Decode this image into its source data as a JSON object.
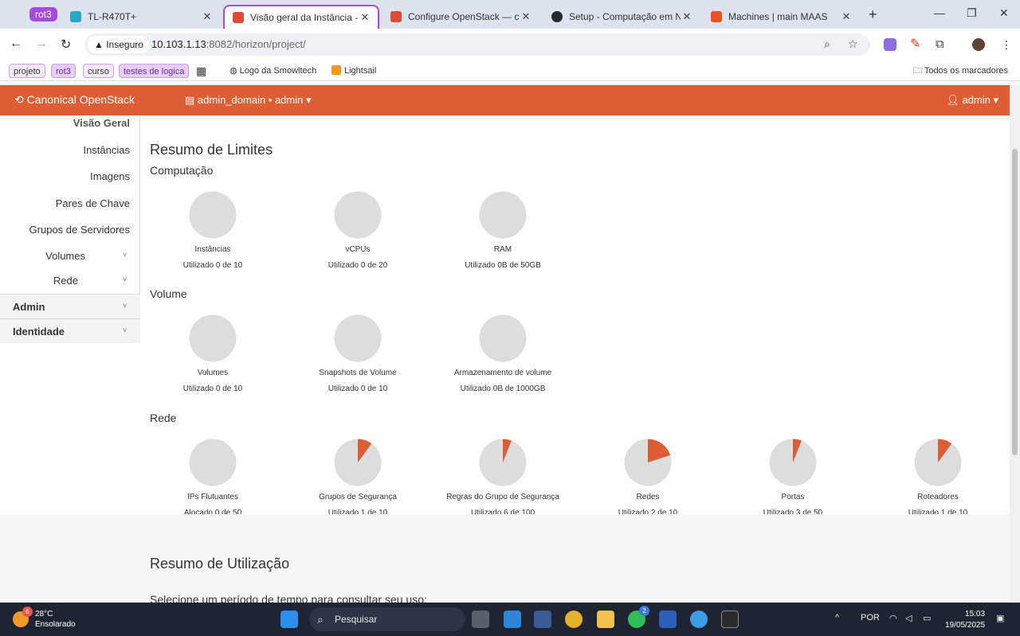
{
  "browser": {
    "tab_group": "rot3",
    "tabs": [
      {
        "title": "TL-R470T+",
        "icon": "tp-link-icon",
        "color": "#2aa6c9"
      },
      {
        "title": "Visão geral da Instância - Op",
        "icon": "openstack-icon",
        "color": "#dd4b39",
        "active": true
      },
      {
        "title": "Configure OpenStack — charm",
        "icon": "openstack-icon",
        "color": "#dd4b39"
      },
      {
        "title": "Setup - Computação em Nuvem",
        "icon": "github-icon",
        "color": "#24292e"
      },
      {
        "title": "Machines | main MAAS",
        "icon": "maas-icon",
        "color": "#e95420"
      }
    ],
    "security_label": "Inseguro",
    "url_host": "10.103.1.13",
    "url_rest": ":8082/horizon/project/",
    "bookmarks": [
      "projeto",
      "rot3",
      "curso",
      "testes de logica",
      "Logo da Smowltech",
      "Lightsail"
    ],
    "all_bookmarks": "Todos os marcadores"
  },
  "header": {
    "brand": "Canonical OpenStack",
    "project_selector": "admin_domain • admin",
    "user": "admin"
  },
  "sidebar": {
    "current": "Visão Geral",
    "items": [
      "Instâncias",
      "Imagens",
      "Pares de Chave",
      "Grupos de Servidores",
      "Volumes",
      "Rede"
    ],
    "sections": [
      "Admin",
      "Identidade"
    ]
  },
  "main": {
    "title": "Resumo de Limites",
    "groups": [
      {
        "title": "Computação",
        "charts": [
          {
            "label": "Instâncias",
            "usage": "Utilizado 0 de 10",
            "fraction": 0
          },
          {
            "label": "vCPUs",
            "usage": "Utilizado 0 de 20",
            "fraction": 0
          },
          {
            "label": "RAM",
            "usage": "Utilizado 0B de 50GB",
            "fraction": 0
          }
        ]
      },
      {
        "title": "Volume",
        "charts": [
          {
            "label": "Volumes",
            "usage": "Utilizado 0 de 10",
            "fraction": 0
          },
          {
            "label": "Snapshots de Volume",
            "usage": "Utilizado 0 de 10",
            "fraction": 0
          },
          {
            "label": "Armazenamento de volume",
            "usage": "Utilizado 0B de 1000GB",
            "fraction": 0
          }
        ]
      },
      {
        "title": "Rede",
        "charts": [
          {
            "label": "IPs Flutuantes",
            "usage": "Alocado 0 de 50",
            "fraction": 0
          },
          {
            "label": "Grupos de Segurança",
            "usage": "Utilizado 1 de 10",
            "fraction": 0.1
          },
          {
            "label": "Regras do Grupo de Segurança",
            "usage": "Utilizado 6 de 100",
            "fraction": 0.06
          },
          {
            "label": "Redes",
            "usage": "Utilizado 2 de 10",
            "fraction": 0.2
          },
          {
            "label": "Portas",
            "usage": "Utilizado 3 de 50",
            "fraction": 0.06
          },
          {
            "label": "Roteadores",
            "usage": "Utilizado 1 de 10",
            "fraction": 0.1
          }
        ]
      }
    ],
    "usage_title": "Resumo de Utilização",
    "usage_subtitle": "Selecione um período de tempo para consultar seu uso:"
  },
  "colors": {
    "accent": "#dd5e35",
    "pie_empty": "#dddddd",
    "pie_fill": "#dd5e35"
  },
  "taskbar": {
    "temperature": "28°C",
    "weather": "Ensolarado",
    "weather_badge": "6",
    "search": "Pesquisar",
    "whatsapp_badge": "2",
    "language": "POR",
    "time": "15:03",
    "date": "19/05/2025"
  }
}
